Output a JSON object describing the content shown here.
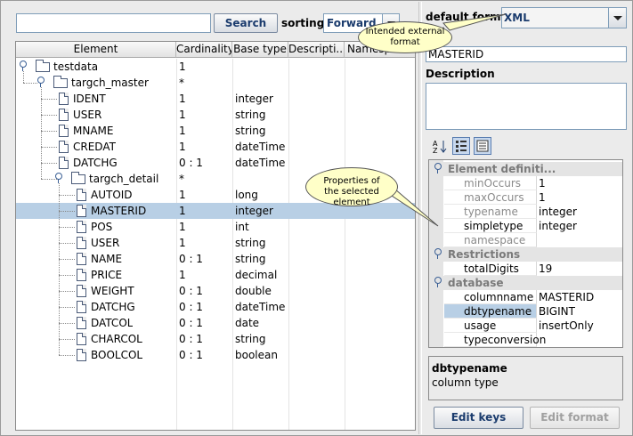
{
  "search": {
    "value": "",
    "button": "Search"
  },
  "sorting": {
    "label": "sorting:",
    "value": "Forward"
  },
  "table": {
    "columns": [
      "Element",
      "Cardinality",
      "Base type",
      "Descripti...",
      "Namespace"
    ],
    "rows": [
      {
        "name": "testdata",
        "card": "1",
        "type": "",
        "kind": "folder",
        "level": 0
      },
      {
        "name": "targch_master",
        "card": "*",
        "type": "",
        "kind": "folder",
        "level": 1
      },
      {
        "name": "IDENT",
        "card": "1",
        "type": "integer",
        "kind": "doc",
        "level": 2
      },
      {
        "name": "USER",
        "card": "1",
        "type": "string",
        "kind": "doc",
        "level": 2
      },
      {
        "name": "MNAME",
        "card": "1",
        "type": "string",
        "kind": "doc",
        "level": 2
      },
      {
        "name": "CREDAT",
        "card": "1",
        "type": "dateTime",
        "kind": "doc",
        "level": 2
      },
      {
        "name": "DATCHG",
        "card": "0 : 1",
        "type": "dateTime",
        "kind": "doc",
        "level": 2
      },
      {
        "name": "targch_detail",
        "card": "*",
        "type": "",
        "kind": "folder",
        "level": 2
      },
      {
        "name": "AUTOID",
        "card": "1",
        "type": "long",
        "kind": "doc",
        "level": 3
      },
      {
        "name": "MASTERID",
        "card": "1",
        "type": "integer",
        "kind": "doc",
        "level": 3,
        "selected": true
      },
      {
        "name": "POS",
        "card": "1",
        "type": "int",
        "kind": "doc",
        "level": 3
      },
      {
        "name": "USER",
        "card": "1",
        "type": "string",
        "kind": "doc",
        "level": 3
      },
      {
        "name": "NAME",
        "card": "0 : 1",
        "type": "string",
        "kind": "doc",
        "level": 3
      },
      {
        "name": "PRICE",
        "card": "1",
        "type": "decimal",
        "kind": "doc",
        "level": 3
      },
      {
        "name": "WEIGHT",
        "card": "0 : 1",
        "type": "double",
        "kind": "doc",
        "level": 3
      },
      {
        "name": "DATCHG",
        "card": "0 : 1",
        "type": "dateTime",
        "kind": "doc",
        "level": 3
      },
      {
        "name": "DATCOL",
        "card": "0 : 1",
        "type": "date",
        "kind": "doc",
        "level": 3
      },
      {
        "name": "CHARCOL",
        "card": "0 : 1",
        "type": "string",
        "kind": "doc",
        "level": 3
      },
      {
        "name": "BOOLCOL",
        "card": "0 : 1",
        "type": "boolean",
        "kind": "doc",
        "level": 3
      }
    ]
  },
  "format": {
    "label": "default format",
    "value": "XML"
  },
  "name_field": "MASTERID",
  "description": {
    "label": "Description",
    "value": ""
  },
  "callouts": {
    "format": "Intended external format",
    "props": "Properties of the selected element"
  },
  "properties": [
    {
      "cat": "Element definiti...",
      "items": [
        {
          "name": "minOccurs",
          "value": "1",
          "grey": true
        },
        {
          "name": "maxOccurs",
          "value": "1",
          "grey": true
        },
        {
          "name": "typename",
          "value": "integer",
          "grey": true
        },
        {
          "name": "simpletype",
          "value": "integer"
        },
        {
          "name": "namespace",
          "value": "",
          "grey": true
        }
      ]
    },
    {
      "cat": "Restrictions",
      "items": [
        {
          "name": "totalDigits",
          "value": "19"
        }
      ]
    },
    {
      "cat": "database",
      "items": [
        {
          "name": "columnname",
          "value": "MASTERID"
        },
        {
          "name": "dbtypename",
          "value": "BIGINT",
          "selected": true
        },
        {
          "name": "usage",
          "value": "insertOnly"
        },
        {
          "name": "typeconversion",
          "value": ""
        }
      ]
    }
  ],
  "help": {
    "title": "dbtypename",
    "text": "column type"
  },
  "buttons": {
    "edit_keys": "Edit keys",
    "edit_format": "Edit format"
  }
}
